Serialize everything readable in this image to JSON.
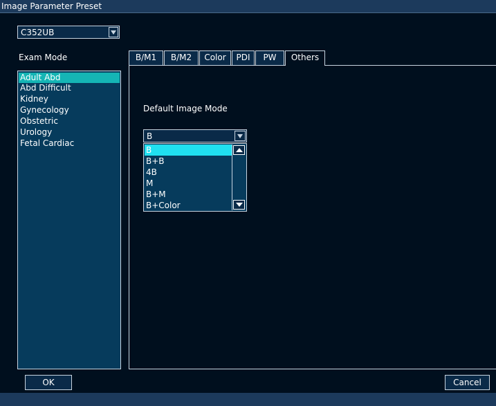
{
  "window": {
    "title": "Image Parameter Preset"
  },
  "probe": {
    "selected": "C352UB"
  },
  "exam_mode": {
    "label": "Exam Mode",
    "items": [
      "Adult Abd",
      "Abd Difficult",
      "Kidney",
      "Gynecology",
      "Obstetric",
      "Urology",
      "Fetal Cardiac"
    ],
    "selected_index": 0
  },
  "tabs": [
    {
      "label": "B/M1"
    },
    {
      "label": "B/M2"
    },
    {
      "label": "Color"
    },
    {
      "label": "PDI"
    },
    {
      "label": "PW"
    },
    {
      "label": "Others",
      "active": true
    }
  ],
  "others_panel": {
    "default_image_mode_label": "Default Image Mode",
    "default_image_mode_value": "B",
    "options": [
      "B",
      "B+B",
      "4B",
      "M",
      "B+M",
      "B+Color"
    ],
    "highlighted_option": "B"
  },
  "buttons": {
    "ok": "OK",
    "cancel": "Cancel"
  },
  "colors": {
    "background": "#000f1e",
    "title_bar": "#1c3a5c",
    "list_background": "#063b5c",
    "selection_teal": "#15b5b5",
    "dropdown_highlight": "#20e0f0"
  }
}
